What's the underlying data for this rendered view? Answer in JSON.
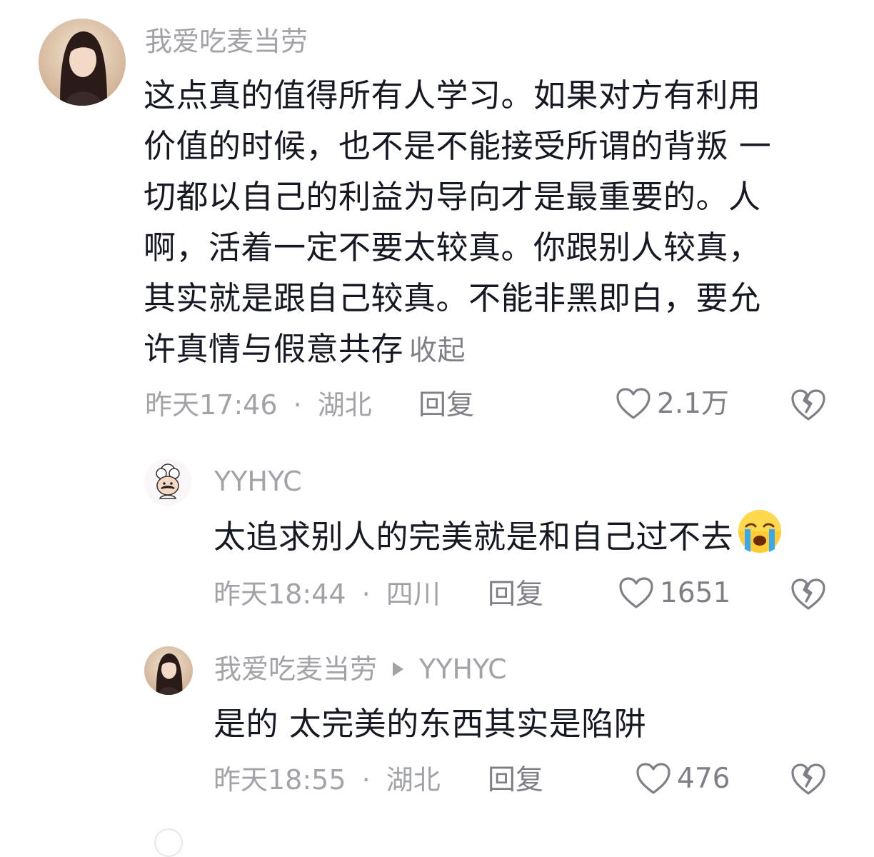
{
  "comments": [
    {
      "username": "我爱吃麦当劳",
      "text_lines": [
        "这点真的值得所有人学习。如果对方有利用",
        "价值的时候，也不是不能接受所谓的背叛 一",
        "切都以自己的利益为导向才是最重要的。人",
        "啊，活着一定不要太较真。你跟别人较真，",
        "其实就是跟自己较真。不能非黑即白，要允",
        "许真情与假意共存"
      ],
      "collapse_label": "收起",
      "time": "昨天17:46",
      "separator": "·",
      "location": "湖北",
      "reply_label": "回复",
      "likes": "2.1万",
      "avatar_icon": "girl-portrait-avatar"
    },
    {
      "username": "YYHYC",
      "text": "太追求别人的完美就是和自己过不去",
      "emoji": "loudly-crying-face-emoji",
      "time": "昨天18:44",
      "separator": "·",
      "location": "四川",
      "reply_label": "回复",
      "likes": "1651",
      "avatar_icon": "cartoon-chef-avatar"
    },
    {
      "username": "我爱吃麦当劳",
      "reply_to": "YYHYC",
      "text": "是的 太完美的东西其实是陷阱",
      "time": "昨天18:55",
      "separator": "·",
      "location": "湖北",
      "reply_label": "回复",
      "likes": "476",
      "avatar_icon": "girl-portrait-avatar"
    }
  ],
  "colors": {
    "text_primary": "#161823",
    "text_secondary": "#a2a3a8",
    "text_action": "#7f8087"
  }
}
